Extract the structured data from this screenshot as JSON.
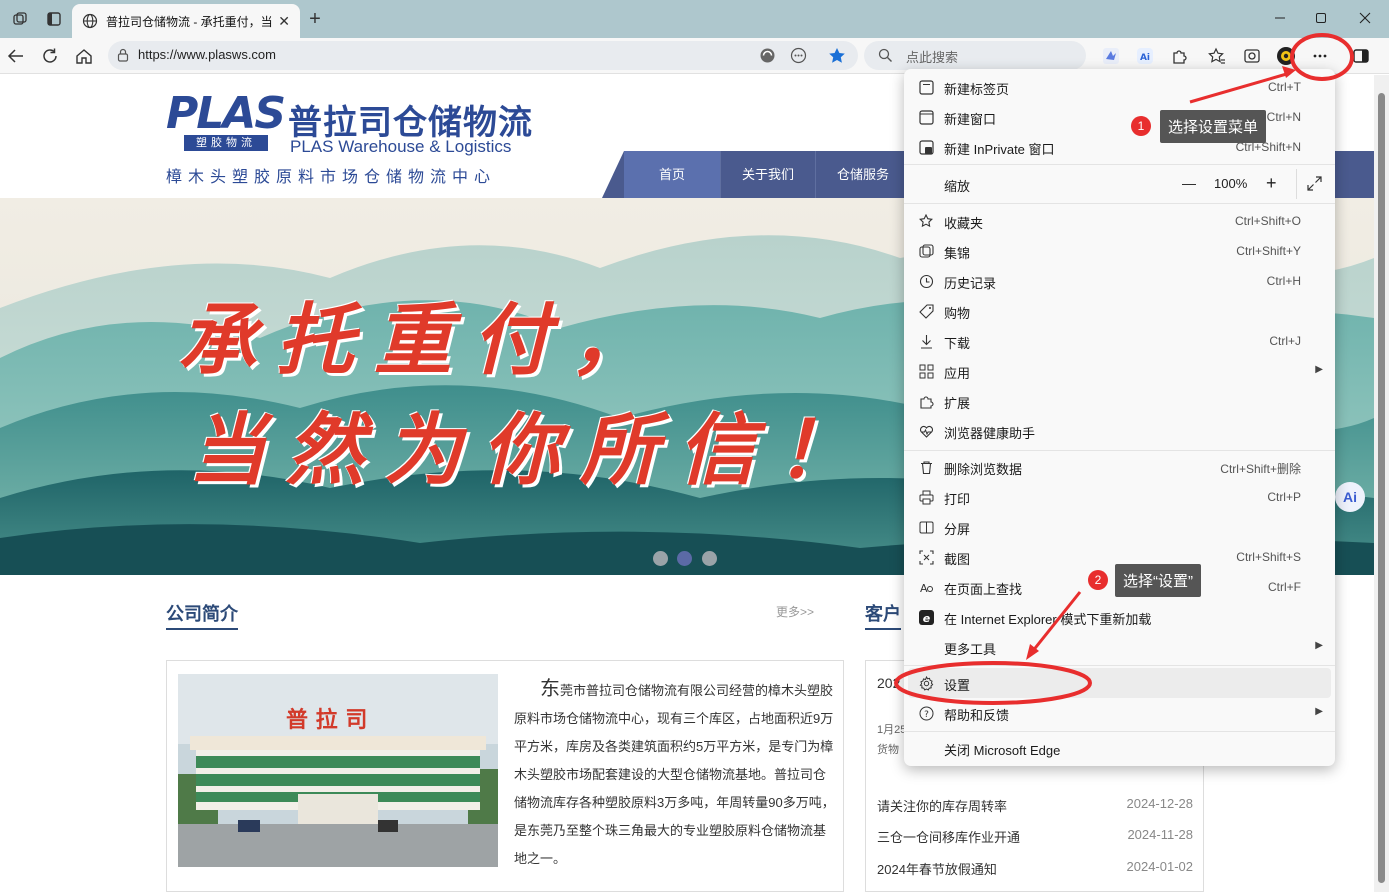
{
  "tab": {
    "title": "普拉司仓储物流 - 承托重付，当你",
    "close": "✕",
    "new_tab": "+"
  },
  "address_bar": {
    "url": "https://www.plasws.com",
    "search_placeholder": "点此搜索"
  },
  "site": {
    "logo_plas": "PLAS",
    "logo_sub": "塑胶物流",
    "logo_cn": "普拉司仓储物流",
    "logo_en": "PLAS Warehouse & Logistics",
    "logo_tagline": "樟木头塑胶原料市场仓储物流中心",
    "nav": [
      "首页",
      "关于我们",
      "仓储服务"
    ],
    "slogan_line1": "承托重付，",
    "slogan_line2": "当然为你所信！",
    "photo_sign": "普 拉 司",
    "section_intro": "公司简介",
    "intro_more": "更多>>",
    "intro_first_char": "东",
    "intro_text": "莞市普拉司仓储物流有限公司经营的樟木头塑胶原料市场仓储物流中心，现有三个库区，占地面积近9万平方米，库房及各类建筑面积约5万平方米，是专门为樟木头塑胶市场配套建设的大型仓储物流基地。普拉司仓储物流库存各种塑胶原料3万多吨，年周转量90多万吨，是东莞乃至整个珠三角最大的专业塑胶原料仓储物流基地之一。",
    "section_client": "客户",
    "news_partial": [
      "202",
      "1月25",
      "货物"
    ],
    "news": [
      {
        "title": "请关注你的库存周转率",
        "date": "2024-12-28"
      },
      {
        "title": "三仓一仓间移库作业开通",
        "date": "2024-11-28"
      },
      {
        "title": "2024年春节放假通知",
        "date": "2024-01-02"
      }
    ]
  },
  "menu": {
    "items": [
      {
        "label": "新建标签页",
        "shortcut": "Ctrl+T"
      },
      {
        "label": "新建窗口",
        "shortcut": "Ctrl+N"
      },
      {
        "label": "新建 InPrivate 窗口",
        "shortcut": "Ctrl+Shift+N"
      },
      {
        "label": "缩放",
        "zoom": "100%",
        "minus": "—",
        "plus": "+"
      },
      {
        "label": "收藏夹",
        "shortcut": "Ctrl+Shift+O"
      },
      {
        "label": "集锦",
        "shortcut": "Ctrl+Shift+Y"
      },
      {
        "label": "历史记录",
        "shortcut": "Ctrl+H"
      },
      {
        "label": "购物",
        "shortcut": ""
      },
      {
        "label": "下载",
        "shortcut": "Ctrl+J"
      },
      {
        "label": "应用",
        "shortcut": ""
      },
      {
        "label": "扩展",
        "shortcut": ""
      },
      {
        "label": "浏览器健康助手",
        "shortcut": ""
      },
      {
        "label": "删除浏览数据",
        "shortcut": "Ctrl+Shift+删除"
      },
      {
        "label": "打印",
        "shortcut": "Ctrl+P"
      },
      {
        "label": "分屏",
        "shortcut": ""
      },
      {
        "label": "截图",
        "shortcut": "Ctrl+Shift+S"
      },
      {
        "label": "在页面上查找",
        "shortcut": "Ctrl+F"
      },
      {
        "label": "在 Internet Explorer 模式下重新加载",
        "shortcut": ""
      },
      {
        "label": "更多工具",
        "shortcut": ""
      },
      {
        "label": "设置",
        "shortcut": ""
      },
      {
        "label": "帮助和反馈",
        "shortcut": ""
      },
      {
        "label": "关闭 Microsoft Edge",
        "shortcut": ""
      }
    ]
  },
  "annotations": {
    "step1_num": "1",
    "step1_text": "选择设置菜单",
    "step2_num": "2",
    "step2_text": "选择“设置”",
    "accent": "#e82e2e"
  },
  "ai_badge": "Ai",
  "colors": {
    "brand_blue": "#2c4a96",
    "nav_band": "#4a5a8e",
    "slogan_red": "#e03a2a",
    "tabbar": "#aec7cd"
  }
}
